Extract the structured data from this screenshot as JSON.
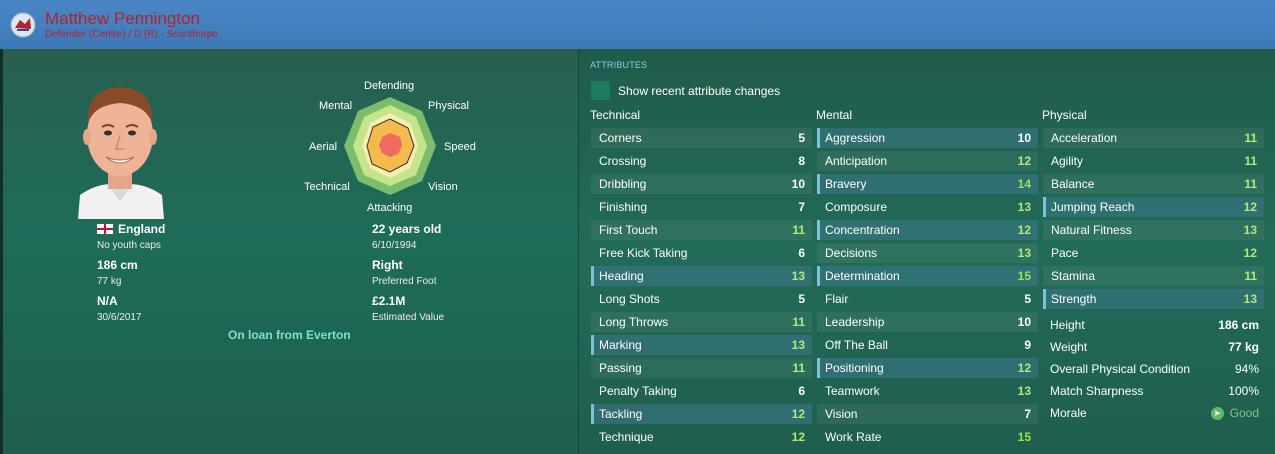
{
  "header": {
    "name": "Matthew Pennington",
    "subtitle": "Defender (Centre) / D (R) - Scunthorpe",
    "colors": {
      "bar": "#4382c1",
      "name": "#b3222e"
    }
  },
  "profile": {
    "nationality": "England",
    "youth_caps": "No youth caps",
    "height": "186 cm",
    "weight": "77 kg",
    "contract_label": "N/A",
    "contract_date": "30/6/2017",
    "age": "22 years old",
    "dob": "6/10/1994",
    "foot": "Right",
    "foot_label": "Preferred Foot",
    "value": "£2.1M",
    "value_label": "Estimated Value",
    "loan_text": "On loan from Everton"
  },
  "radar": {
    "labels": [
      "Defending",
      "Physical",
      "Speed",
      "Vision",
      "Attacking",
      "Technical",
      "Aerial",
      "Mental"
    ]
  },
  "attributes": {
    "title": "ATTRIBUTES",
    "toggle_label": "Show recent attribute changes",
    "technical": {
      "heading": "Technical",
      "items": [
        {
          "name": "Corners",
          "value": "5"
        },
        {
          "name": "Crossing",
          "value": "8"
        },
        {
          "name": "Dribbling",
          "value": "10"
        },
        {
          "name": "Finishing",
          "value": "7"
        },
        {
          "name": "First Touch",
          "value": "11"
        },
        {
          "name": "Free Kick Taking",
          "value": "6"
        },
        {
          "name": "Heading",
          "value": "13"
        },
        {
          "name": "Long Shots",
          "value": "5"
        },
        {
          "name": "Long Throws",
          "value": "11"
        },
        {
          "name": "Marking",
          "value": "13"
        },
        {
          "name": "Passing",
          "value": "11"
        },
        {
          "name": "Penalty Taking",
          "value": "6"
        },
        {
          "name": "Tackling",
          "value": "12"
        },
        {
          "name": "Technique",
          "value": "12"
        }
      ]
    },
    "mental": {
      "heading": "Mental",
      "items": [
        {
          "name": "Aggression",
          "value": "10"
        },
        {
          "name": "Anticipation",
          "value": "12"
        },
        {
          "name": "Bravery",
          "value": "14"
        },
        {
          "name": "Composure",
          "value": "13"
        },
        {
          "name": "Concentration",
          "value": "12"
        },
        {
          "name": "Decisions",
          "value": "13"
        },
        {
          "name": "Determination",
          "value": "15"
        },
        {
          "name": "Flair",
          "value": "5"
        },
        {
          "name": "Leadership",
          "value": "10"
        },
        {
          "name": "Off The Ball",
          "value": "9"
        },
        {
          "name": "Positioning",
          "value": "12"
        },
        {
          "name": "Teamwork",
          "value": "13"
        },
        {
          "name": "Vision",
          "value": "7"
        },
        {
          "name": "Work Rate",
          "value": "15"
        }
      ]
    },
    "physical": {
      "heading": "Physical",
      "items": [
        {
          "name": "Acceleration",
          "value": "11"
        },
        {
          "name": "Agility",
          "value": "11"
        },
        {
          "name": "Balance",
          "value": "11"
        },
        {
          "name": "Jumping Reach",
          "value": "12"
        },
        {
          "name": "Natural Fitness",
          "value": "13"
        },
        {
          "name": "Pace",
          "value": "12"
        },
        {
          "name": "Stamina",
          "value": "11"
        },
        {
          "name": "Strength",
          "value": "13"
        }
      ]
    },
    "stats": [
      {
        "name": "Height",
        "value": "186 cm"
      },
      {
        "name": "Weight",
        "value": "77 kg"
      },
      {
        "name": "Overall Physical Condition",
        "value": "94%"
      },
      {
        "name": "Match Sharpness",
        "value": "100%"
      },
      {
        "name": "Morale",
        "value": "Good",
        "icon": "arrow-up-icon"
      }
    ]
  }
}
